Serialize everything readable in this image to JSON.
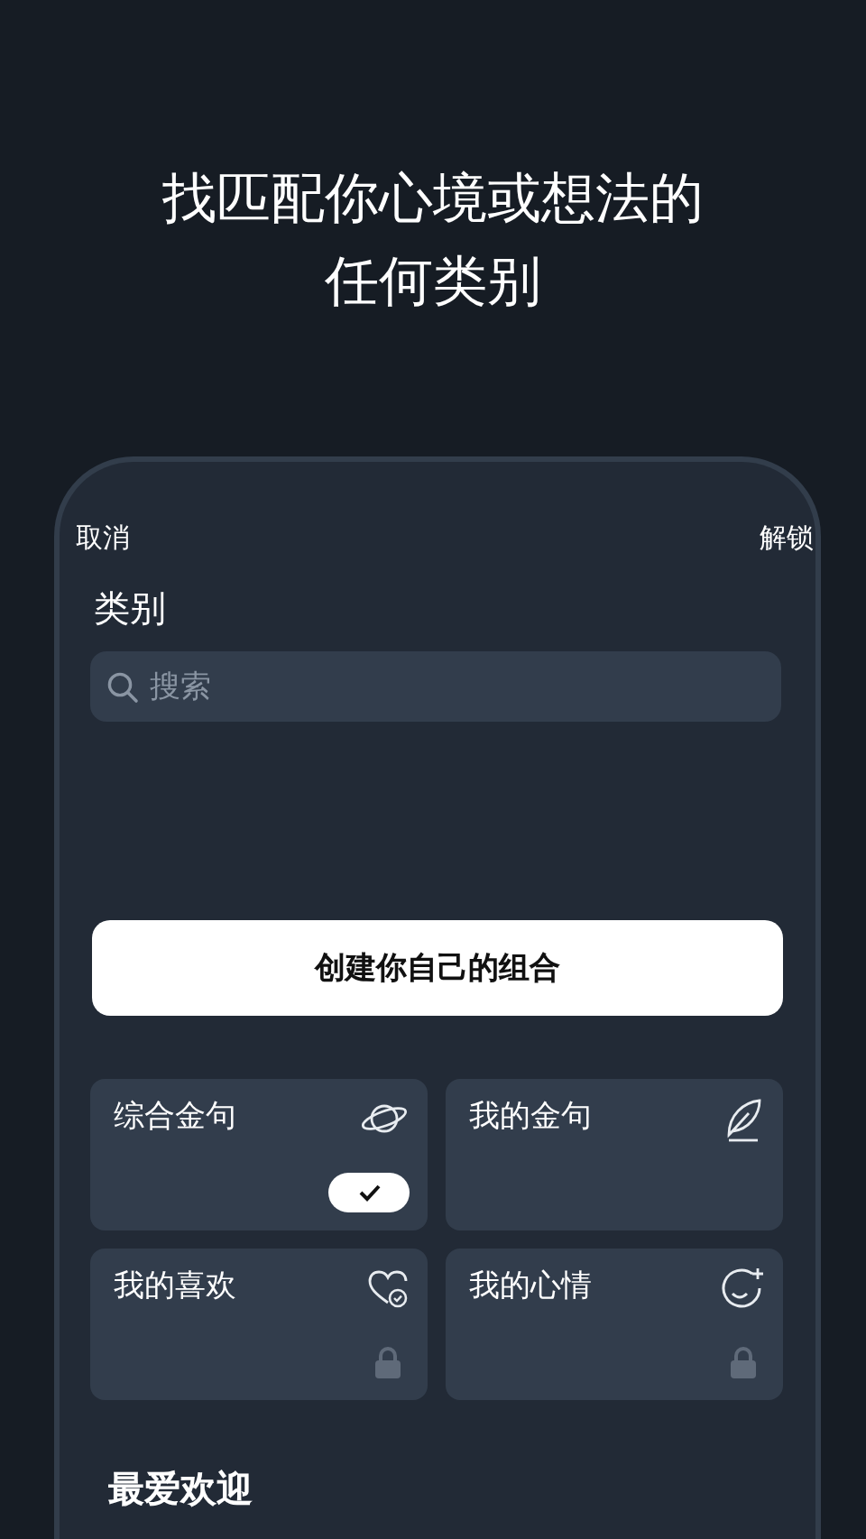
{
  "headline": [
    "找匹配你心境或想法的",
    "任何类别"
  ],
  "top_bar": {
    "cancel": "取消",
    "unlock": "解锁"
  },
  "section_title": "类别",
  "search": {
    "placeholder": "搜索"
  },
  "create_button": "创建你自己的组合",
  "categories": [
    {
      "label": "综合金句",
      "selected": true,
      "locked": false
    },
    {
      "label": "我的金句",
      "selected": false,
      "locked": false
    },
    {
      "label": "我的喜欢",
      "selected": false,
      "locked": true
    },
    {
      "label": "我的心情",
      "selected": false,
      "locked": true
    }
  ],
  "popular_title": "最爱欢迎"
}
